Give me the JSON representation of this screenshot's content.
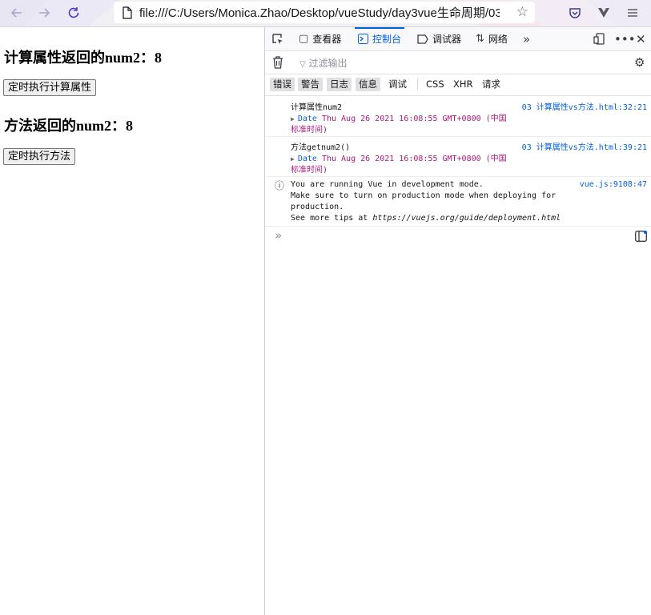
{
  "browser": {
    "url": "file:///C:/Users/Monica.Zhao/Desktop/vueStudy/day3vue生命周期/03",
    "icons": [
      "back-icon",
      "forward-icon",
      "reload-icon",
      "page-icon",
      "star-icon",
      "pocket-icon",
      "vue-devtools-icon",
      "menu-icon"
    ]
  },
  "page": {
    "heading1": "计算属性返回的num2：8",
    "button1": "定时执行计算属性",
    "heading2": "方法返回的num2：8",
    "button2": "定时执行方法"
  },
  "devtools": {
    "tabs": [
      {
        "label": "查看器",
        "icon": "inspector-icon"
      },
      {
        "label": "控制台",
        "icon": "console-icon",
        "active": true
      },
      {
        "label": "调试器",
        "icon": "debugger-icon"
      },
      {
        "label": "网络",
        "icon": "network-icon"
      }
    ],
    "filter_placeholder": "过滤输出",
    "levels": [
      {
        "label": "错误",
        "on": true
      },
      {
        "label": "警告",
        "on": true
      },
      {
        "label": "日志",
        "on": true
      },
      {
        "label": "信息",
        "on": true
      },
      {
        "label": "调试",
        "on": false
      },
      {
        "label": "CSS",
        "on": false
      },
      {
        "label": "XHR",
        "on": false
      },
      {
        "label": "请求",
        "on": false
      }
    ],
    "messages": [
      {
        "text": "计算属性num2",
        "date_key": "Date",
        "date_value_1": "Thu Aug 26 2021 16:08:55 GMT+0800 (中国",
        "date_value_2": "标准时间)",
        "source": "03 计算属性vs方法.html:32:21"
      },
      {
        "text": "方法getnum2()",
        "date_key": "Date",
        "date_value_1": "Thu Aug 26 2021 16:08:55 GMT+0800 (中国",
        "date_value_2": "标准时间)",
        "source": "03 计算属性vs方法.html:39:21"
      },
      {
        "line1": "You are running Vue in development mode.",
        "line2": "Make sure to turn on production mode when deploying for",
        "line3": "production.",
        "line4_prefix": "See more tips at ",
        "line4_link": "https://vuejs.org/guide/deployment.html",
        "source": "vue.js:9108:47"
      }
    ],
    "colors": {
      "accent": "#0060df",
      "date_value": "#b1177d"
    }
  }
}
